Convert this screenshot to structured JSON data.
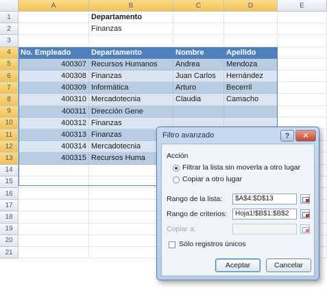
{
  "columns": [
    "A",
    "B",
    "C",
    "D",
    "E"
  ],
  "rows": [
    "1",
    "2",
    "3",
    "4",
    "5",
    "6",
    "7",
    "8",
    "9",
    "10",
    "11",
    "12",
    "13",
    "14",
    "15",
    "16",
    "17",
    "18",
    "19",
    "20",
    "21"
  ],
  "criteria": {
    "header": "Departamento",
    "value": "Finanzas"
  },
  "table": {
    "headers": [
      "No. Empleado",
      "Departamento",
      "Nombre",
      "Apellido"
    ],
    "records": [
      [
        "400307",
        "Recursos Humanos",
        "Andrea",
        "Mendoza"
      ],
      [
        "400308",
        "Finanzas",
        "Juan Carlos",
        "Hernández"
      ],
      [
        "400309",
        "Informática",
        "Arturo",
        "Becerril"
      ],
      [
        "400310",
        "Mercadotecnia",
        "Claudia",
        "Camacho"
      ],
      [
        "400311",
        "Dirección Gene",
        "",
        ""
      ],
      [
        "400312",
        "Finanzas",
        "",
        ""
      ],
      [
        "400313",
        "Finanzas",
        "",
        ""
      ],
      [
        "400314",
        "Mercadotecnia",
        "",
        ""
      ],
      [
        "400315",
        "Recursos Huma",
        "",
        ""
      ]
    ]
  },
  "dialog": {
    "title": "Filtro avanzado",
    "help_label": "?",
    "close_label": "✕",
    "action_group_label": "Acción",
    "option_filter_in_place": "Filtrar la lista sin moverla a otro lugar",
    "option_copy": "Copiar a otro lugar",
    "list_range_label": "Rango de la lista:",
    "list_range_value": "$A$4:$D$13",
    "criteria_range_label": "Rango de criterios:",
    "criteria_range_value": "Hoja1!$B$1:$B$2",
    "copy_to_label": "Copiar a:",
    "copy_to_value": "",
    "unique_label": "Sólo registros únicos",
    "ok_label": "Aceptar",
    "cancel_label": "Cancelar",
    "selected_option": "filter_in_place",
    "unique_checked": false
  },
  "colors": {
    "table_header": "#4f81bd",
    "band_light": "#dbe5f1",
    "band_dark": "#b8cce4",
    "dialog_frame": "#c6d9f0"
  }
}
